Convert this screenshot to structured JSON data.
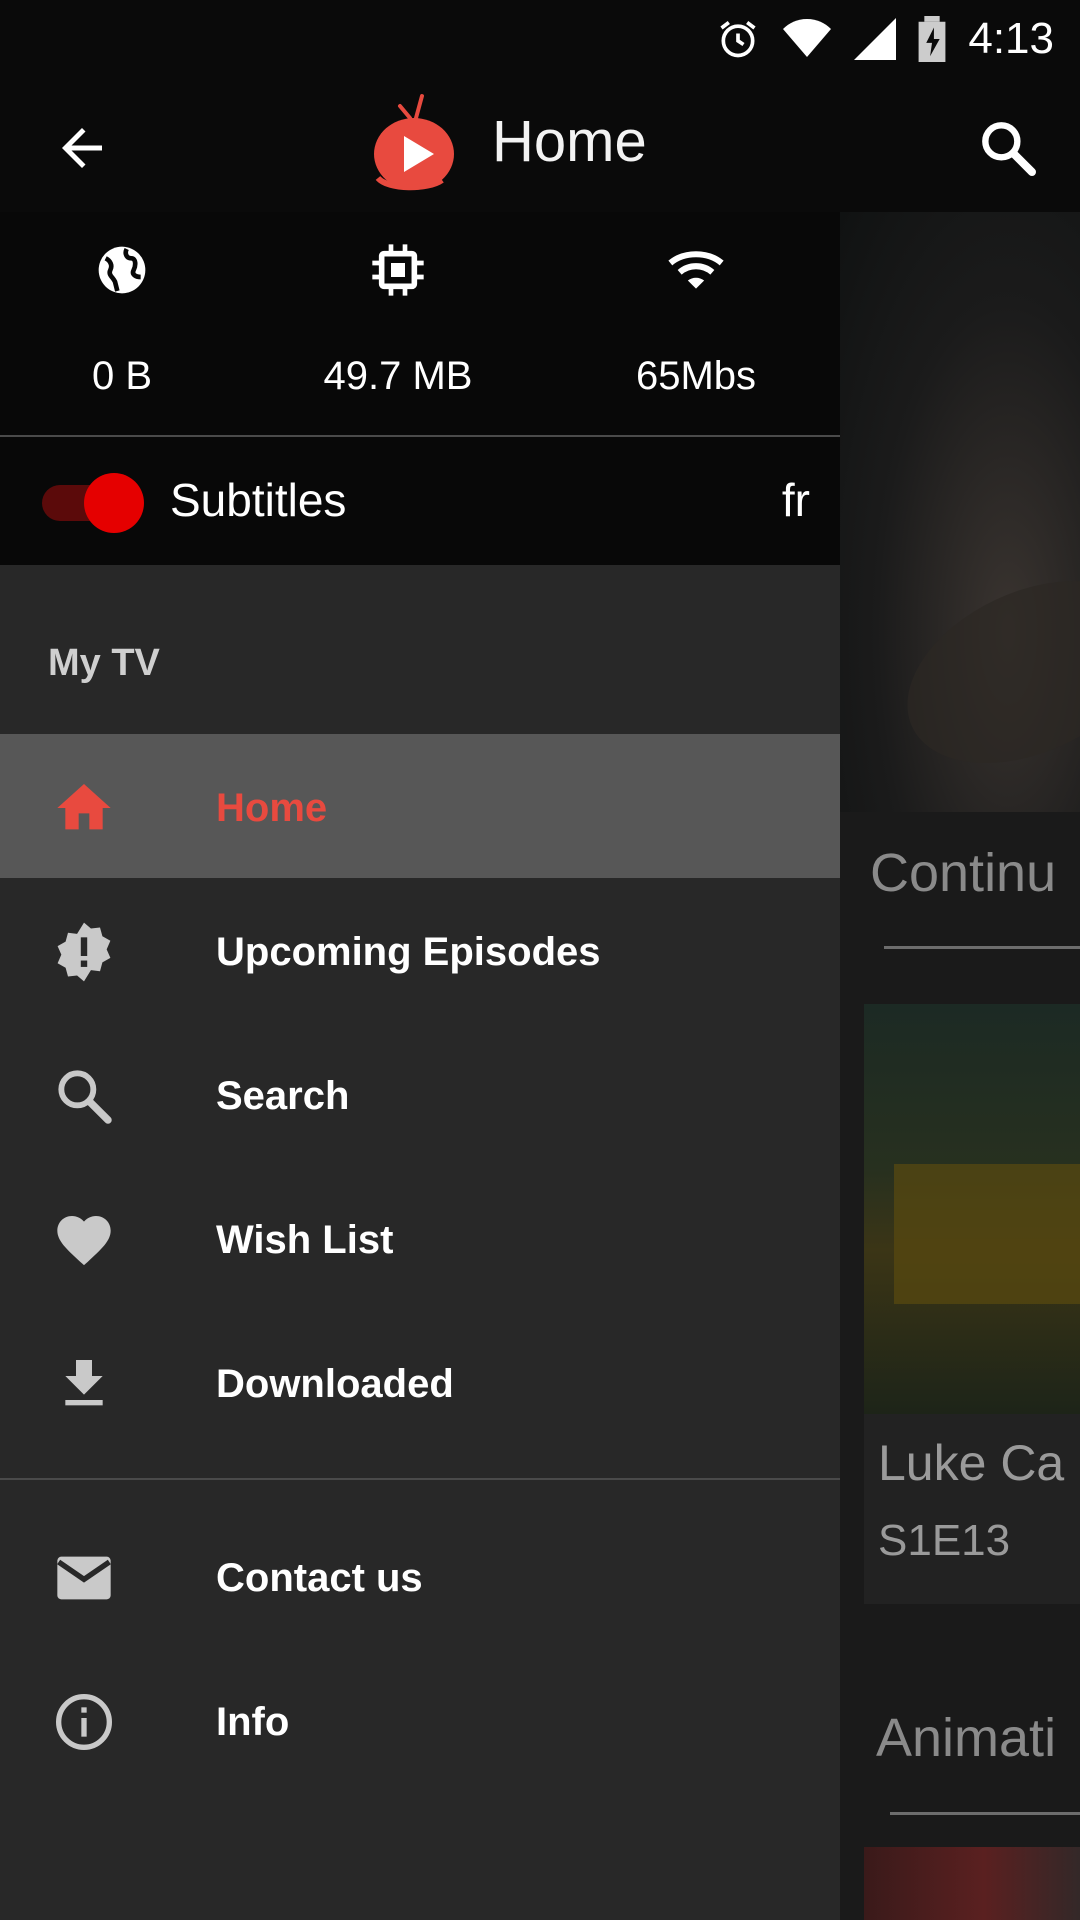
{
  "status_bar": {
    "time": "4:13"
  },
  "app_bar": {
    "title": "Home"
  },
  "stats": [
    {
      "icon": "globe-icon",
      "value": "0 B"
    },
    {
      "icon": "memory-chip-icon",
      "value": "49.7 MB"
    },
    {
      "icon": "wifi-icon",
      "value": "65Mbs"
    }
  ],
  "subtitles": {
    "label": "Subtitles",
    "language": "fr",
    "enabled": true
  },
  "drawer": {
    "section_title": "My TV",
    "items": [
      {
        "label": "Home",
        "icon": "home-icon",
        "active": true
      },
      {
        "label": "Upcoming Episodes",
        "icon": "alert-badge-icon"
      },
      {
        "label": "Search",
        "icon": "search-icon"
      },
      {
        "label": "Wish List",
        "icon": "heart-icon"
      },
      {
        "label": "Downloaded",
        "icon": "download-icon"
      },
      {
        "label": "Contact us",
        "icon": "mail-icon"
      },
      {
        "label": "Info",
        "icon": "info-icon"
      }
    ]
  },
  "background": {
    "section1_title": "Continu",
    "card_title": "Luke Ca",
    "card_subtitle": "S1E13",
    "section2_title": "Animati"
  },
  "colors": {
    "accent": "#e84a3f",
    "toggle_thumb": "#e50000",
    "drawer_bg": "#282828",
    "active_bg": "#575757"
  }
}
